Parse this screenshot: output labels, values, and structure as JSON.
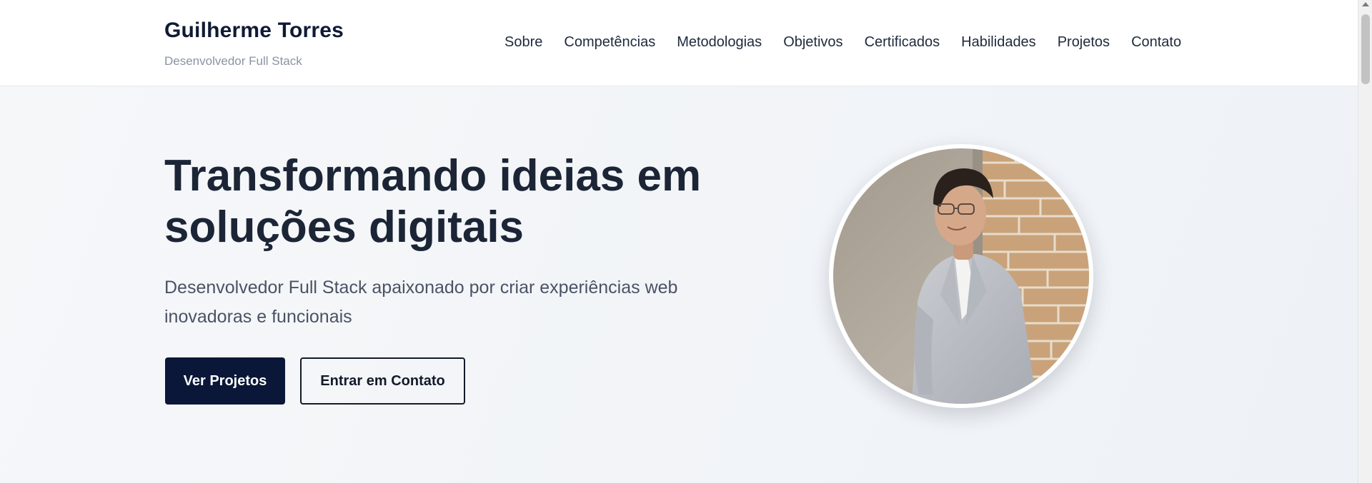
{
  "header": {
    "brand_name": "Guilherme Torres",
    "brand_subtitle": "Desenvolvedor Full Stack",
    "nav": [
      {
        "label": "Sobre"
      },
      {
        "label": "Competências"
      },
      {
        "label": "Metodologias"
      },
      {
        "label": "Objetivos"
      },
      {
        "label": "Certificados"
      },
      {
        "label": "Habilidades"
      },
      {
        "label": "Projetos"
      },
      {
        "label": "Contato"
      }
    ]
  },
  "hero": {
    "headline_line1": "Transformando ideias em",
    "headline_line2": "soluções digitais",
    "subtitle_line1": "Desenvolvedor Full Stack apaixonado por criar experiências web",
    "subtitle_line2": "inovadoras e funcionais",
    "primary_button": "Ver Projetos",
    "secondary_button": "Entrar em Contato",
    "avatar_icon": "profile-photo"
  },
  "colors": {
    "accent": "#0a1738",
    "text_dark": "#1c2536",
    "text_muted": "#8a93a3",
    "background": "#f4f6f9"
  }
}
